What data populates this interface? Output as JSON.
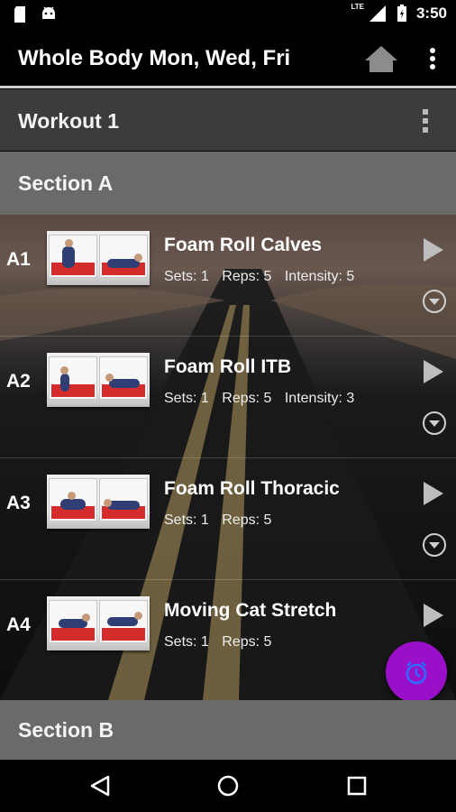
{
  "status_bar": {
    "network": "LTE",
    "time": "3:50"
  },
  "app_bar": {
    "title": "Whole Body Mon, Wed, Fri"
  },
  "workout": {
    "title": "Workout 1"
  },
  "sections": [
    {
      "title": "Section A"
    },
    {
      "title": "Section B"
    }
  ],
  "exercises": [
    {
      "code": "A1",
      "name": "Foam Roll Calves",
      "sets": "Sets: 1",
      "reps": "Reps: 5",
      "intensity": "Intensity: 5"
    },
    {
      "code": "A2",
      "name": "Foam Roll ITB",
      "sets": "Sets: 1",
      "reps": "Reps: 5",
      "intensity": "Intensity: 3"
    },
    {
      "code": "A3",
      "name": "Foam Roll Thoracic",
      "sets": "Sets: 1",
      "reps": "Reps: 5"
    },
    {
      "code": "A4",
      "name": "Moving Cat Stretch",
      "sets": "Sets: 1",
      "reps": "Reps: 5"
    }
  ],
  "icons": {
    "home": "home-icon",
    "menu": "more-vert-icon",
    "play": "play-icon",
    "expand": "expand-circle-icon",
    "fab": "alarm-icon",
    "back": "back-triangle-icon",
    "nav_home": "home-circle-icon",
    "recents": "recents-square-icon"
  },
  "colors": {
    "fab": "#9a10c8",
    "section_bg": "#6a6a6a",
    "workout_bg": "#3c3c3c"
  }
}
